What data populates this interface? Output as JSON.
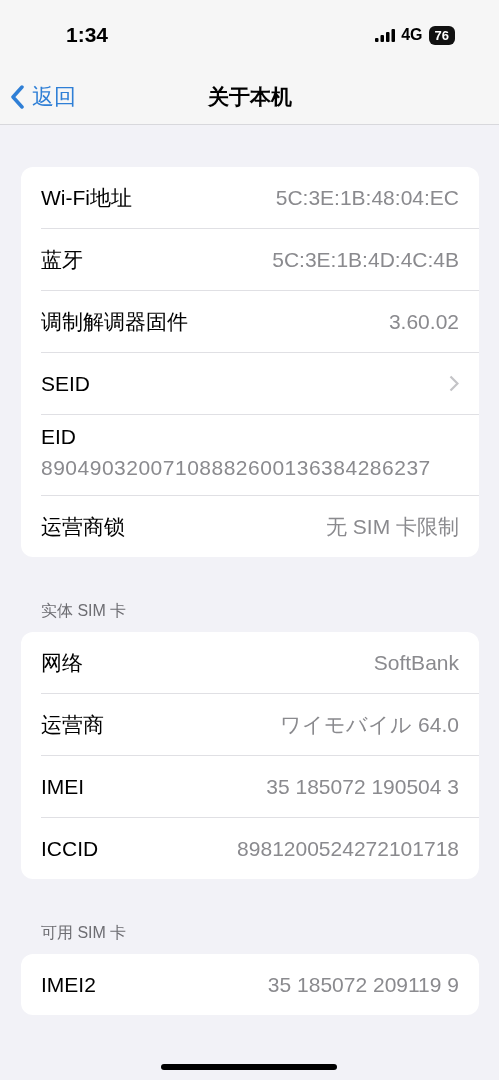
{
  "status_bar": {
    "time": "1:34",
    "network": "4G",
    "battery": "76"
  },
  "nav": {
    "back": "返回",
    "title": "关于本机"
  },
  "sections": [
    {
      "rows": [
        {
          "kind": "value",
          "label": "Wi-Fi地址",
          "value": "5C:3E:1B:48:04:EC"
        },
        {
          "kind": "value",
          "label": "蓝牙",
          "value": "5C:3E:1B:4D:4C:4B"
        },
        {
          "kind": "value",
          "label": "调制解调器固件",
          "value": "3.60.02"
        },
        {
          "kind": "chevron",
          "label": "SEID"
        },
        {
          "kind": "stacked",
          "label": "EID",
          "value": "89049032007108882600136384286237"
        },
        {
          "kind": "value",
          "label": "运营商锁",
          "value": "无 SIM 卡限制"
        }
      ]
    },
    {
      "header": "实体 SIM 卡",
      "rows": [
        {
          "kind": "value",
          "label": "网络",
          "value": "SoftBank"
        },
        {
          "kind": "value",
          "label": "运营商",
          "value": "ワイモバイル 64.0"
        },
        {
          "kind": "value",
          "label": "IMEI",
          "value": "35 185072 190504 3"
        },
        {
          "kind": "value",
          "label": "ICCID",
          "value": "8981200524272101718"
        }
      ]
    },
    {
      "header": "可用 SIM 卡",
      "rows": [
        {
          "kind": "value",
          "label": "IMEI2",
          "value": "35 185072 209119 9"
        }
      ]
    }
  ]
}
